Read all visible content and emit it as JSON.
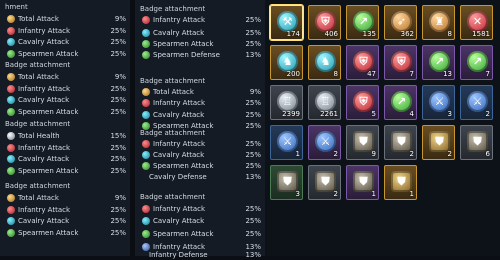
{
  "left_column": {
    "sections": [
      {
        "header": "hment",
        "rows": [
          {
            "icon": "total-attack-icon",
            "label": "Total Attack",
            "value": "9%"
          },
          {
            "icon": "infantry-icon",
            "label": "Infantry Attack",
            "value": "25%"
          },
          {
            "icon": "cavalry-icon",
            "label": "Cavalry Attack",
            "value": "25%"
          },
          {
            "icon": "spearmen-icon",
            "label": "Spearmen Attack",
            "value": "25%"
          }
        ]
      },
      {
        "header": "Badge attachment",
        "rows": [
          {
            "icon": "total-attack-icon",
            "label": "Total Attack",
            "value": "9%"
          },
          {
            "icon": "infantry-icon",
            "label": "Infantry Attack",
            "value": "25%"
          },
          {
            "icon": "cavalry-icon",
            "label": "Cavalry Attack",
            "value": "25%"
          },
          {
            "icon": "spearmen-icon",
            "label": "Spearmen Attack",
            "value": "25%"
          }
        ]
      },
      {
        "header": "Badge attachment",
        "rows": [
          {
            "icon": "total-health-icon",
            "label": "Total Health",
            "value": "15%"
          },
          {
            "icon": "infantry-icon",
            "label": "Infantry Attack",
            "value": "25%"
          },
          {
            "icon": "cavalry-icon",
            "label": "Cavalry Attack",
            "value": "25%"
          },
          {
            "icon": "spearmen-icon",
            "label": "Spearmen Attack",
            "value": "25%"
          }
        ]
      },
      {
        "header": "Badge attachment",
        "rows": [
          {
            "icon": "total-attack-icon",
            "label": "Total Attack",
            "value": "9%"
          },
          {
            "icon": "infantry-icon",
            "label": "Infantry Attack",
            "value": "25%"
          },
          {
            "icon": "cavalry-icon",
            "label": "Cavalry Attack",
            "value": "25%"
          },
          {
            "icon": "spearmen-icon",
            "label": "Spearmen Attack",
            "value": "25%"
          }
        ]
      }
    ]
  },
  "right_column": {
    "sections": [
      {
        "header": "Badge attachment",
        "rows": [
          {
            "icon": "infantry-icon",
            "label": "Infantry Attack",
            "value": "25%"
          },
          {
            "icon": "cavalry-icon",
            "label": "Cavalry Attack",
            "value": "25%"
          },
          {
            "icon": "spearmen-icon",
            "label": "Spearmen Attack",
            "value": "25%"
          },
          {
            "icon": "spearmen-icon",
            "label": "Spearmen Defense",
            "value": "13%"
          }
        ]
      },
      {
        "header": "Badge attachment",
        "rows": [
          {
            "icon": "total-attack-icon",
            "label": "Total Attack",
            "value": "9%"
          },
          {
            "icon": "infantry-icon",
            "label": "Infantry Attack",
            "value": "25%"
          },
          {
            "icon": "cavalry-icon",
            "label": "Cavalry Attack",
            "value": "25%"
          },
          {
            "icon": "spearmen-icon",
            "label": "Spearmen Attack",
            "value": "25%"
          }
        ]
      },
      {
        "header": "Badge attachment",
        "rows": [
          {
            "icon": "infantry-icon",
            "label": "Infantry Attack",
            "value": "25%"
          },
          {
            "icon": "cavalry-icon",
            "label": "Cavalry Attack",
            "value": "25%"
          },
          {
            "icon": "spearmen-icon",
            "label": "Spearmen Attack",
            "value": "25%"
          },
          {
            "icon": "",
            "label": "Cavalry Defense",
            "value": "13%"
          }
        ]
      },
      {
        "header": "Badge attachment",
        "rows": [
          {
            "icon": "infantry-icon",
            "label": "Infantry Attack",
            "value": "25%"
          },
          {
            "icon": "cavalry-icon",
            "label": "Cavalry Attack",
            "value": "25%"
          },
          {
            "icon": "spearmen-icon",
            "label": "Spearmen Attack",
            "value": "25%"
          },
          {
            "icon": "archer-icon",
            "label": "Infantry Attack",
            "value": "13%"
          },
          {
            "icon": "",
            "label": "Infantry Defense",
            "value": "13%"
          }
        ]
      }
    ]
  },
  "inventory": {
    "items": [
      {
        "frame": "gold",
        "gem": "cyan",
        "glyph": "axe-icon",
        "count": "174",
        "selected": true
      },
      {
        "frame": "gold",
        "gem": "red",
        "glyph": "shield-icon",
        "count": "406"
      },
      {
        "frame": "gold",
        "gem": "green",
        "glyph": "spear-icon",
        "count": "135"
      },
      {
        "frame": "gold",
        "gem": "orange",
        "glyph": "bow-icon",
        "count": "362"
      },
      {
        "frame": "gold",
        "gem": "orange",
        "glyph": "tower-icon",
        "count": "8"
      },
      {
        "frame": "gold",
        "gem": "red",
        "glyph": "cross-swords-icon",
        "count": "1581"
      },
      {
        "frame": "gold",
        "gem": "cyan",
        "glyph": "horse-icon",
        "count": "200"
      },
      {
        "frame": "gold",
        "gem": "cyan",
        "glyph": "horse-icon",
        "count": "8"
      },
      {
        "frame": "purple",
        "gem": "red",
        "glyph": "shield-icon",
        "count": "47"
      },
      {
        "frame": "purple",
        "gem": "red",
        "glyph": "shield-icon",
        "count": "7"
      },
      {
        "frame": "purple",
        "gem": "green",
        "glyph": "spear-icon",
        "count": "13"
      },
      {
        "frame": "purple",
        "gem": "green",
        "glyph": "spear-icon",
        "count": "7"
      },
      {
        "frame": "grey",
        "gem": "steel",
        "glyph": "castle-icon",
        "count": "2399"
      },
      {
        "frame": "grey",
        "gem": "steel",
        "glyph": "castle-icon",
        "count": "2261"
      },
      {
        "frame": "purple",
        "gem": "red",
        "glyph": "shield-icon",
        "count": "5"
      },
      {
        "frame": "purple",
        "gem": "green",
        "glyph": "spear-icon",
        "count": "4"
      },
      {
        "frame": "blue",
        "gem": "blue",
        "glyph": "sword-icon",
        "count": "3"
      },
      {
        "frame": "blue",
        "gem": "blue",
        "glyph": "sword-icon",
        "count": "2"
      },
      {
        "frame": "blue",
        "gem": "blue",
        "glyph": "sword-icon",
        "count": "1"
      },
      {
        "frame": "purple",
        "gem": "blue",
        "glyph": "sword-icon",
        "count": "2"
      },
      {
        "frame": "grey",
        "gem": "armor",
        "glyph": "armor-icon",
        "count": "9"
      },
      {
        "frame": "grey",
        "gem": "armor",
        "glyph": "armor-icon",
        "count": "2"
      },
      {
        "frame": "gold",
        "gem": "armorgold",
        "glyph": "armor-icon",
        "count": "2"
      },
      {
        "frame": "grey",
        "gem": "armor",
        "glyph": "armor-icon",
        "count": "6"
      },
      {
        "frame": "green",
        "gem": "armor",
        "glyph": "armor-icon",
        "count": "3"
      },
      {
        "frame": "grey",
        "gem": "armor",
        "glyph": "armor-icon",
        "count": "2"
      },
      {
        "frame": "purple",
        "gem": "armor",
        "glyph": "armor-icon",
        "count": "1"
      },
      {
        "frame": "gold",
        "gem": "armorgold",
        "glyph": "armor-icon",
        "count": "1"
      }
    ]
  }
}
